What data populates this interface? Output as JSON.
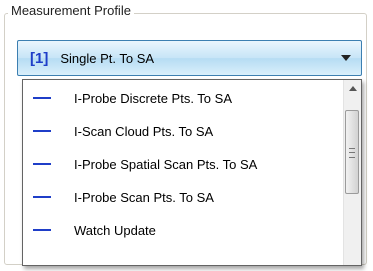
{
  "group": {
    "title": "Measurement Profile"
  },
  "combo": {
    "index": "[1]",
    "selected": "Single Pt. To SA"
  },
  "dropdown": {
    "items": [
      {
        "label": "I-Probe Discrete Pts. To SA"
      },
      {
        "label": "I-Scan Cloud Pts. To SA"
      },
      {
        "label": "I-Probe Spatial Scan Pts. To SA"
      },
      {
        "label": "I-Probe Scan Pts. To SA"
      },
      {
        "label": "Watch Update"
      }
    ]
  },
  "colors": {
    "accent": "#1f3ec8",
    "combo_border": "#3c7fb1"
  },
  "icons": {
    "item_marker": "dash-icon",
    "dropdown_arrow": "chevron-down-icon",
    "scroll_up": "scroll-up-arrow-icon"
  }
}
